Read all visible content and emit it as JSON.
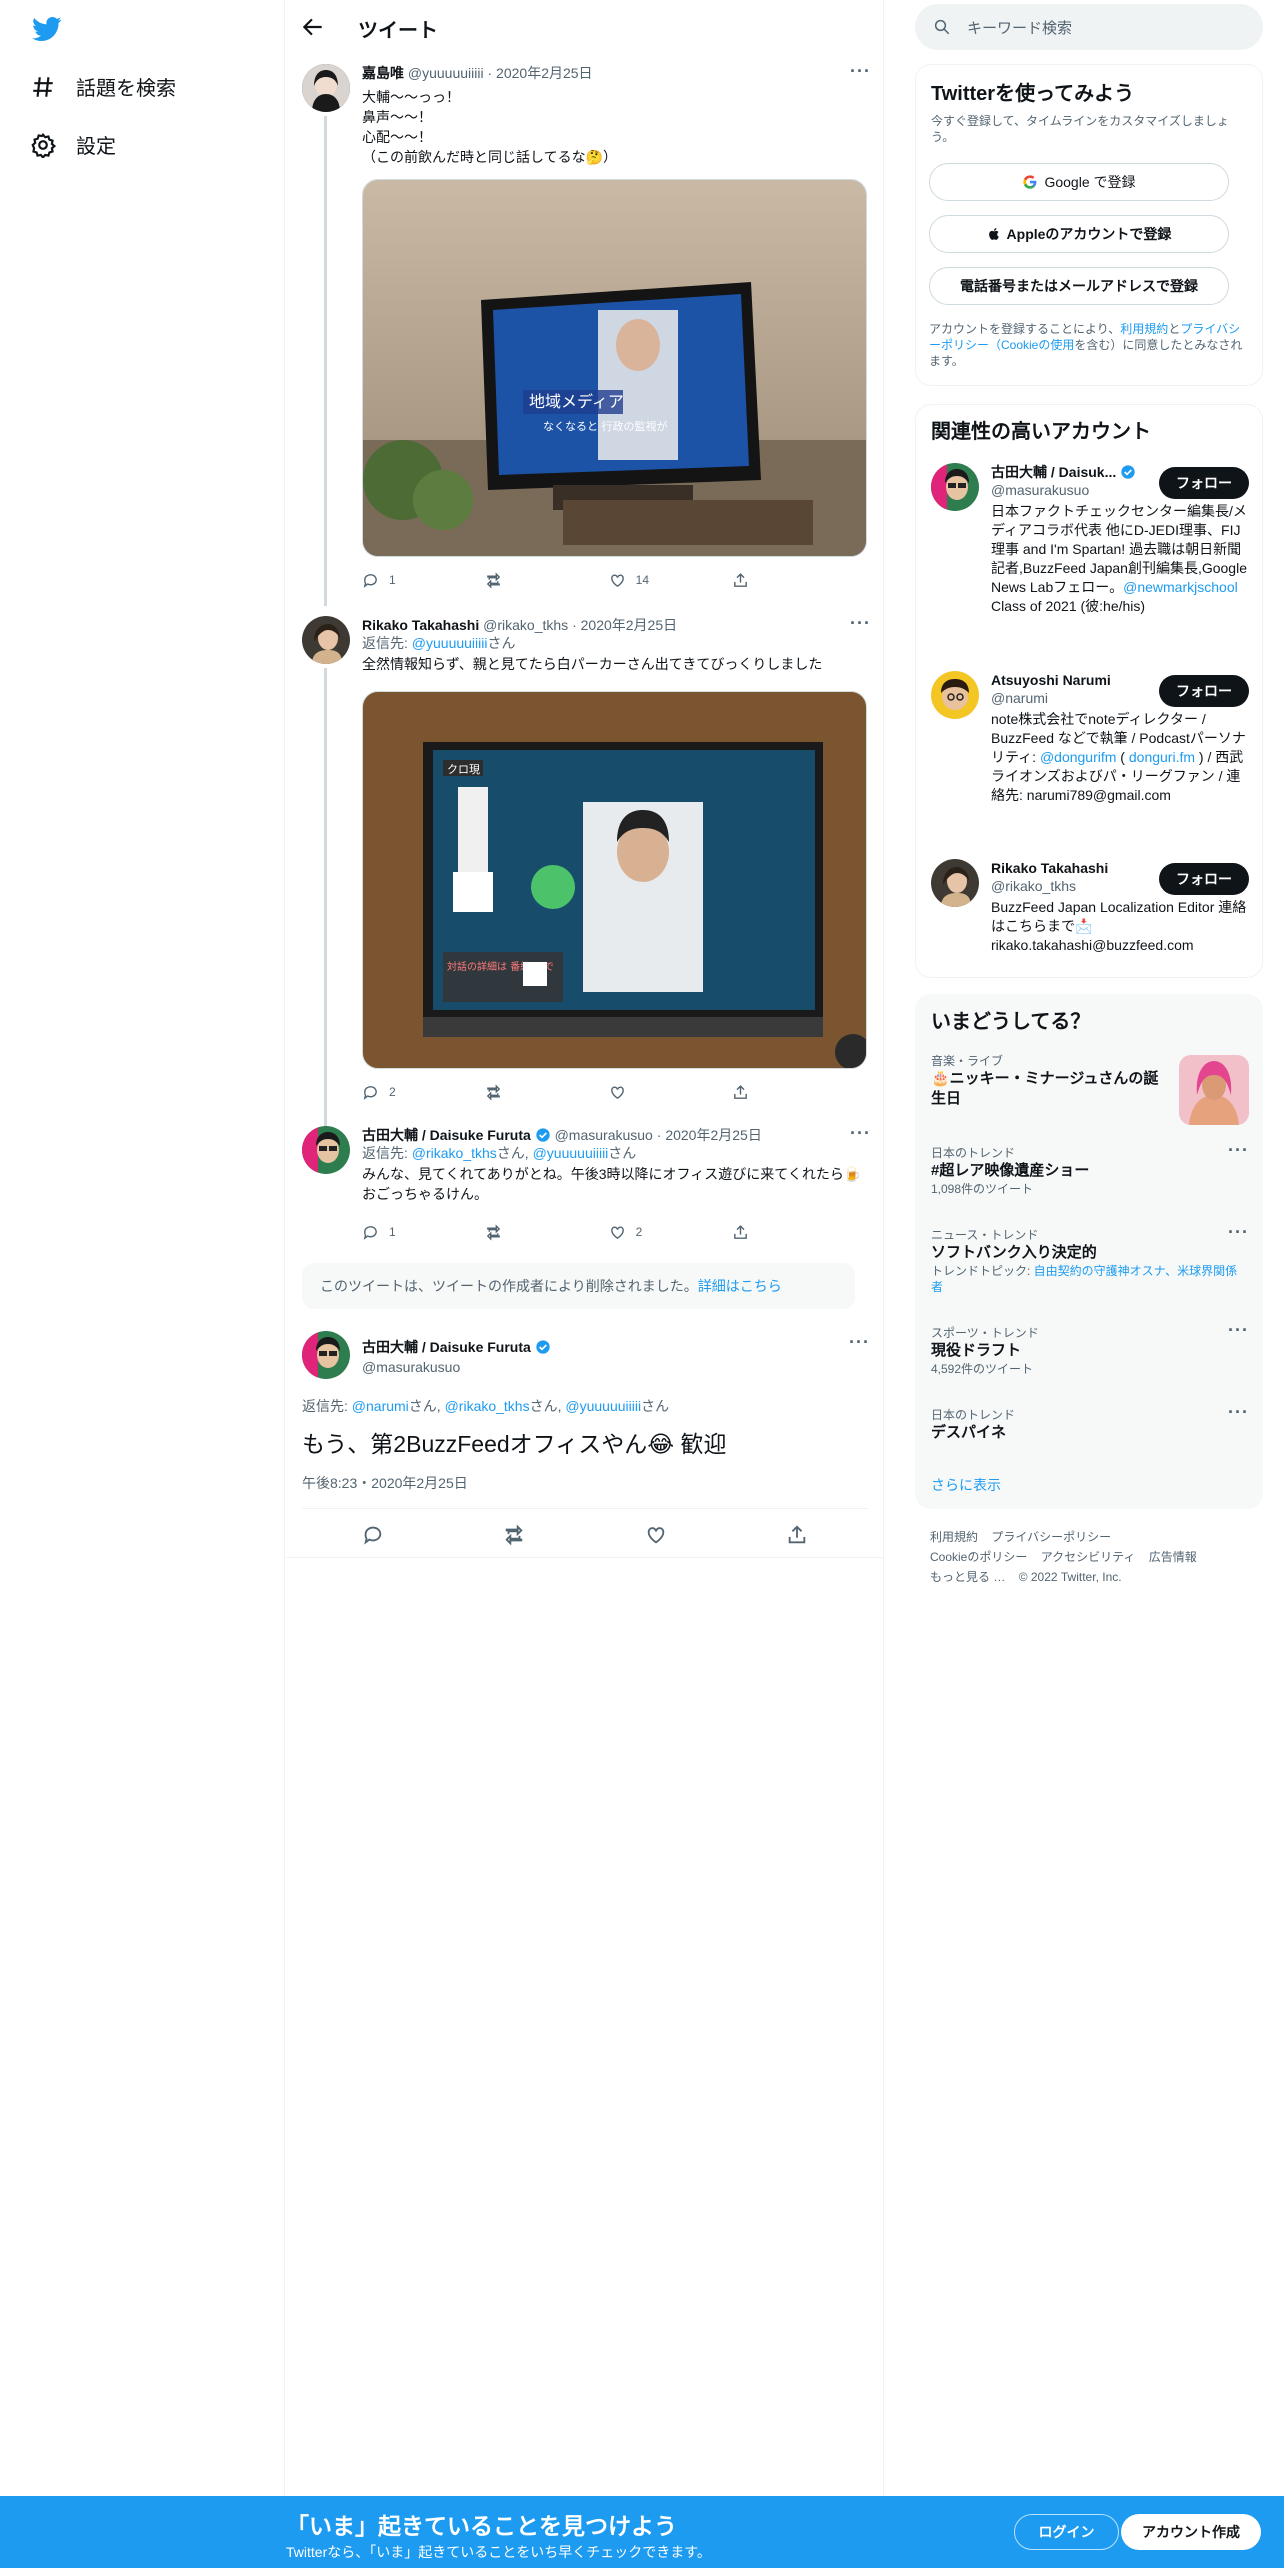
{
  "nav": {
    "explore_label": "話題を検索",
    "settings_label": "設定"
  },
  "header": {
    "title": "ツイート"
  },
  "tweets": [
    {
      "name": "嘉島唯",
      "handle": "@yuuuuuiiiii",
      "date": "2020年2月25日",
      "text": "大輔〜〜っっ！\n鼻声〜〜！\n心配〜〜！\n（この前飲んだ時と同じ話してるな🤔）",
      "replies": "1",
      "retweets": "",
      "likes": "14",
      "media_overlay": "地域メディア",
      "media_overlay_2": "なくなると 行政の監視が"
    },
    {
      "name": "Rikako Takahashi",
      "handle": "@rikako_tkhs",
      "date": "2020年2月25日",
      "reply_prefix": "返信先: ",
      "reply_to": "@yuuuuuiiiii",
      "reply_suffix": "さん",
      "text": "全然情報知らず、親と見てたら白パーカーさん出てきてびっくりしました",
      "replies": "2",
      "retweets": "",
      "likes": "",
      "media_overlay": "クロ現",
      "media_overlay_2": "対話の詳細は 番組HPで"
    },
    {
      "name": "古田大輔 / Daisuke Furuta",
      "handle": "@masurakusuo",
      "date": "2020年2月25日",
      "reply_prefix": "返信先: ",
      "reply_to": "@rikako_tkhs",
      "reply_mid": "さん, ",
      "reply_to_2": "@yuuuuuiiiii",
      "reply_suffix": "さん",
      "text": "みんな、見てくれてありがとね。午後3時以降にオフィス遊びに来てくれたら🍺おごっちゃるけん。",
      "replies": "1",
      "retweets": "",
      "likes": "2"
    }
  ],
  "deleted_notice": {
    "text": "このツイートは、ツイートの作成者により削除されました。",
    "link": "詳細はこちら"
  },
  "focus_tweet": {
    "name": "古田大輔 / Daisuke Furuta",
    "handle": "@masurakusuo",
    "reply_prefix": "返信先: ",
    "reply_to_1": "@narumi",
    "reply_to_2": "@rikako_tkhs",
    "reply_to_3": "@yuuuuuiiiii",
    "san": "さん",
    "san_comma": "さん, ",
    "text": "もう、第2BuzzFeedオフィスやん😂 歓迎",
    "time": "午後8:23・2020年2月25日"
  },
  "search": {
    "placeholder": "キーワード検索"
  },
  "signup": {
    "title": "Twitterを使ってみよう",
    "subtitle": "今すぐ登録して、タイムラインをカスタマイズしましょう。",
    "google": "Google で登録",
    "apple": "Appleのアカウントで登録",
    "phone": "電話番号またはメールアドレスで登録",
    "terms_1": "アカウントを登録することにより、",
    "terms_link_1": "利用規約",
    "terms_2": "と",
    "terms_link_2": "プライバシーポリシー（Cookieの使用",
    "terms_3": "を含む）に同意したとみなされます。"
  },
  "related": {
    "title": "関連性の高いアカウント",
    "follow": "フォロー",
    "accounts": [
      {
        "name": "古田大輔 / Daisuk...",
        "handle": "@masurakusuo",
        "bio": "日本ファクトチェックセンター編集長/メディアコラボ代表 他にD-JEDI理事、FIJ理事 and I'm Spartan! 過去職は朝日新聞記者,BuzzFeed Japan創刊編集長,Google News Labフェロー。",
        "bio_link": "@newmarkjschool",
        "bio_tail": " Class of 2021 (彼:he/his)"
      },
      {
        "name": "Atsuyoshi Narumi",
        "handle": "@narumi",
        "bio": "note株式会社でnoteディレクター / BuzzFeed などで執筆 / Podcastパーソナリティ: ",
        "bio_link": "@dongurifm",
        "bio_mid": " ( ",
        "bio_link_2": "donguri.fm",
        "bio_tail": " ) / 西武ライオンズおよびパ・リーグファン / 連絡先: narumi789@gmail.com"
      },
      {
        "name": "Rikako Takahashi",
        "handle": "@rikako_tkhs",
        "bio": "BuzzFeed Japan Localization Editor 連絡はこちらまで📩 rikako.takahashi@buzzfeed.com"
      }
    ]
  },
  "trends": {
    "title": "いまどうしてる？",
    "items": [
      {
        "category": "音楽・ライブ",
        "name": "🎂ニッキー・ミナージュさんの誕生日",
        "count": ""
      },
      {
        "category": "日本のトレンド",
        "name": "#超レア映像遺産ショー",
        "count": "1,098件のツイート"
      },
      {
        "category": "ニュース・トレンド",
        "name": "ソフトバンク入り決定的",
        "count": "トレンドトピック: ",
        "links": "自由契約の守護神オスナ、米球界関係者"
      },
      {
        "category": "スポーツ・トレンド",
        "name": "現役ドラフト",
        "count": "4,592件のツイート"
      },
      {
        "category": "日本のトレンド",
        "name": "デスパイネ",
        "count": ""
      }
    ],
    "show_more": "さらに表示"
  },
  "footer": {
    "links": [
      "利用規約",
      "プライバシーポリシー",
      "Cookieのポリシー",
      "アクセシビリティ",
      "広告情報",
      "もっと見る …",
      "© 2022 Twitter, Inc."
    ]
  },
  "bottom_bar": {
    "title": "「いま」起きていることを見つけよう",
    "subtitle": "Twitterなら、「いま」起きていることをいち早くチェックできます。",
    "login": "ログイン",
    "signup": "アカウント作成"
  },
  "colors": {
    "brand": "#1d9bf0",
    "text": "#0f1419",
    "muted": "#536471",
    "like": "#f91880"
  }
}
